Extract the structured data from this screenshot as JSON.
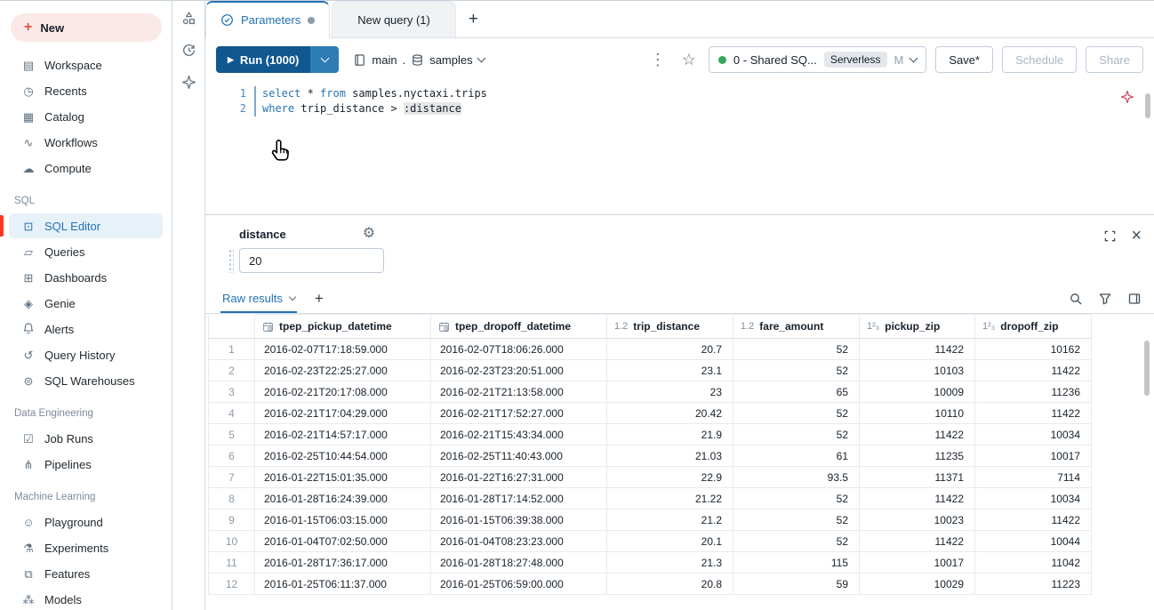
{
  "sidebar": {
    "new_label": "New",
    "new_icon": "+",
    "main_items": [
      {
        "label": "Workspace",
        "icon": "▤"
      },
      {
        "label": "Recents",
        "icon": "◷"
      },
      {
        "label": "Catalog",
        "icon": "▦"
      },
      {
        "label": "Workflows",
        "icon": "∿"
      },
      {
        "label": "Compute",
        "icon": "☁"
      }
    ],
    "sections": [
      {
        "title": "SQL",
        "items": [
          {
            "label": "SQL Editor",
            "icon": "⊡"
          },
          {
            "label": "Queries",
            "icon": "▱"
          },
          {
            "label": "Dashboards",
            "icon": "⊞"
          },
          {
            "label": "Genie",
            "icon": "◈"
          },
          {
            "label": "Alerts",
            "icon": ""
          },
          {
            "label": "Query History",
            "icon": "↺"
          },
          {
            "label": "SQL Warehouses",
            "icon": "⊜"
          }
        ]
      },
      {
        "title": "Data Engineering",
        "items": [
          {
            "label": "Job Runs",
            "icon": "☑"
          },
          {
            "label": "Pipelines",
            "icon": "⋔"
          }
        ]
      },
      {
        "title": "Machine Learning",
        "items": [
          {
            "label": "Playground",
            "icon": "☺"
          },
          {
            "label": "Experiments",
            "icon": "⚗"
          },
          {
            "label": "Features",
            "icon": "⧉"
          },
          {
            "label": "Models",
            "icon": "⁂"
          }
        ]
      }
    ]
  },
  "tabs": {
    "tab1": "Parameters",
    "tab2": "New query (1)",
    "add": "+"
  },
  "toolbar": {
    "run": "Run (1000)",
    "play": "▶",
    "catalog": "main",
    "sep": ".",
    "schema": "samples",
    "kebab": "⋮",
    "star": "☆",
    "warehouse_name": "0 - Shared SQ...",
    "warehouse_badge": "Serverless",
    "warehouse_size": "M",
    "save": "Save*",
    "schedule": "Schedule",
    "share": "Share"
  },
  "editor": {
    "line1_num": "1",
    "line1_kw1": "select",
    "line1_t1": " * ",
    "line1_kw2": "from",
    "line1_t2": " samples.nyctaxi.trips",
    "line2_num": "2",
    "line2_kw1": "where",
    "line2_t1": " trip_distance > ",
    "line2_param": ":distance"
  },
  "params": {
    "name": "distance",
    "value": "20",
    "gear": "⚙"
  },
  "results": {
    "tab_label": "Raw results",
    "add": "+",
    "close": "×",
    "columns": [
      {
        "name": "tpep_pickup_datetime",
        "type": "datetime",
        "glyph": "",
        "align": "left"
      },
      {
        "name": "tpep_dropoff_datetime",
        "type": "datetime",
        "glyph": "",
        "align": "left"
      },
      {
        "name": "trip_distance",
        "type": "float",
        "glyph": "1.2",
        "align": "right"
      },
      {
        "name": "fare_amount",
        "type": "float",
        "glyph": "1.2",
        "align": "right"
      },
      {
        "name": "pickup_zip",
        "type": "int",
        "glyph": "1²₃",
        "align": "right"
      },
      {
        "name": "dropoff_zip",
        "type": "int",
        "glyph": "1²₃",
        "align": "right"
      }
    ],
    "rows": [
      [
        "2016-02-07T17:18:59.000",
        "2016-02-07T18:06:26.000",
        "20.7",
        "52",
        "11422",
        "10162"
      ],
      [
        "2016-02-23T22:25:27.000",
        "2016-02-23T23:20:51.000",
        "23.1",
        "52",
        "10103",
        "11422"
      ],
      [
        "2016-02-21T20:17:08.000",
        "2016-02-21T21:13:58.000",
        "23",
        "65",
        "10009",
        "11236"
      ],
      [
        "2016-02-21T17:04:29.000",
        "2016-02-21T17:52:27.000",
        "20.42",
        "52",
        "10110",
        "11422"
      ],
      [
        "2016-02-21T14:57:17.000",
        "2016-02-21T15:43:34.000",
        "21.9",
        "52",
        "11422",
        "10034"
      ],
      [
        "2016-02-25T10:44:54.000",
        "2016-02-25T11:40:43.000",
        "21.03",
        "61",
        "11235",
        "10017"
      ],
      [
        "2016-01-22T15:01:35.000",
        "2016-01-22T16:27:31.000",
        "22.9",
        "93.5",
        "11371",
        "7114"
      ],
      [
        "2016-01-28T16:24:39.000",
        "2016-01-28T17:14:52.000",
        "21.22",
        "52",
        "11422",
        "10034"
      ],
      [
        "2016-01-15T06:03:15.000",
        "2016-01-15T06:39:38.000",
        "21.2",
        "52",
        "10023",
        "11422"
      ],
      [
        "2016-01-04T07:02:50.000",
        "2016-01-04T08:23:23.000",
        "20.1",
        "52",
        "11422",
        "10044"
      ],
      [
        "2016-01-28T17:36:17.000",
        "2016-01-28T18:27:48.000",
        "21.3",
        "115",
        "10017",
        "11042"
      ],
      [
        "2016-01-25T06:11:37.000",
        "2016-01-25T06:59:00.000",
        "20.8",
        "59",
        "10029",
        "11223"
      ]
    ]
  },
  "colors": {
    "accent_blue": "#2272B4",
    "accent_red": "#FF3621",
    "run_button": "#10588F",
    "status_green": "#3BA65E"
  }
}
